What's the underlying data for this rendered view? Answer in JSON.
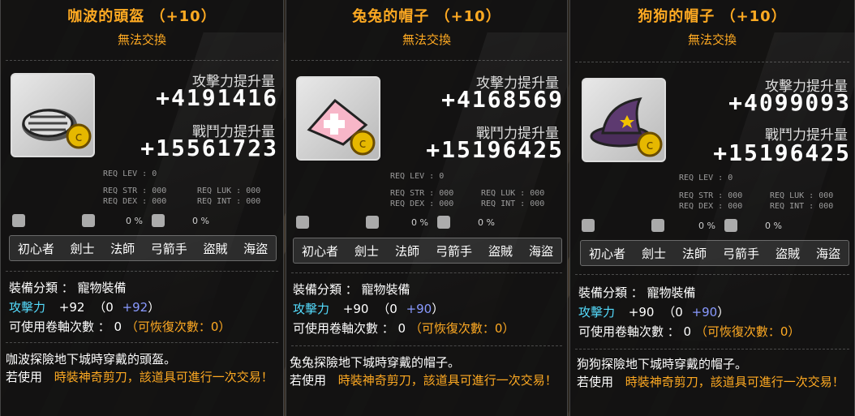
{
  "tooltips": [
    {
      "title": "咖波的頭盔 （+10）",
      "trade": "無法交換",
      "atk_label": "攻擊力提升量",
      "atk_value": "+4191416",
      "power_label": "戰鬥力提升量",
      "power_value": "+15561723",
      "req_lev": "REQ LEV :   0",
      "req_str": "REQ STR : 000",
      "req_luk": "REQ LUK : 000",
      "req_dex": "REQ DEX : 000",
      "req_int": "REQ INT : 000",
      "pct1": "0 %",
      "pct2": "0 %",
      "jobs": [
        "初心者",
        "劍士",
        "法師",
        "弓箭手",
        "盜賊",
        "海盜"
      ],
      "category_label": "裝備分類 ： 寵物裝備",
      "atk_stat_label": "攻擊力",
      "atk_stat_total": "+92",
      "atk_stat_base": "（0",
      "atk_stat_bonus": "+92",
      "atk_stat_close": "）",
      "scroll_label": "可使用卷軸次數 ： 0",
      "scroll_recover": "（可恢復次數：0）",
      "desc_line1": "咖波探險地下城時穿戴的頭盔。",
      "desc_line2_prefix": "若使用",
      "desc_line2_highlight": "時裝神奇剪刀，該道具可進行一次交易！",
      "icon": "helmet-icon"
    },
    {
      "title": "兔兔的帽子 （+10）",
      "trade": "無法交換",
      "atk_label": "攻擊力提升量",
      "atk_value": "+4168569",
      "power_label": "戰鬥力提升量",
      "power_value": "+15196425",
      "req_lev": "REQ LEV :   0",
      "req_str": "REQ STR : 000",
      "req_luk": "REQ LUK : 000",
      "req_dex": "REQ DEX : 000",
      "req_int": "REQ INT : 000",
      "pct1": "0 %",
      "pct2": "0 %",
      "jobs": [
        "初心者",
        "劍士",
        "法師",
        "弓箭手",
        "盜賊",
        "海盜"
      ],
      "category_label": "裝備分類 ： 寵物裝備",
      "atk_stat_label": "攻擊力",
      "atk_stat_total": "+90",
      "atk_stat_base": "（0",
      "atk_stat_bonus": "+90",
      "atk_stat_close": "）",
      "scroll_label": "可使用卷軸次數 ： 0",
      "scroll_recover": "（可恢復次數：0）",
      "desc_line1": "兔兔探險地下城時穿戴的帽子。",
      "desc_line2_prefix": "若使用",
      "desc_line2_highlight": "時裝神奇剪刀，該道具可進行一次交易！",
      "icon": "pink-hat-icon"
    },
    {
      "title": "狗狗的帽子 （+10）",
      "trade": "無法交換",
      "atk_label": "攻擊力提升量",
      "atk_value": "+4099093",
      "power_label": "戰鬥力提升量",
      "power_value": "+15196425",
      "req_lev": "REQ LEV :   0",
      "req_str": "REQ STR : 000",
      "req_luk": "REQ LUK : 000",
      "req_dex": "REQ DEX : 000",
      "req_int": "REQ INT : 000",
      "pct1": "0 %",
      "pct2": "0 %",
      "jobs": [
        "初心者",
        "劍士",
        "法師",
        "弓箭手",
        "盜賊",
        "海盜"
      ],
      "category_label": "裝備分類 ： 寵物裝備",
      "atk_stat_label": "攻擊力",
      "atk_stat_total": "+90",
      "atk_stat_base": "（0",
      "atk_stat_bonus": "+90",
      "atk_stat_close": "）",
      "scroll_label": "可使用卷軸次數 ： 0",
      "scroll_recover": "（可恢復次數：0）",
      "desc_line1": "狗狗探險地下城時穿戴的帽子。",
      "desc_line2_prefix": "若使用",
      "desc_line2_highlight": "時裝神奇剪刀，該道具可進行一次交易！",
      "icon": "witch-hat-icon"
    }
  ]
}
